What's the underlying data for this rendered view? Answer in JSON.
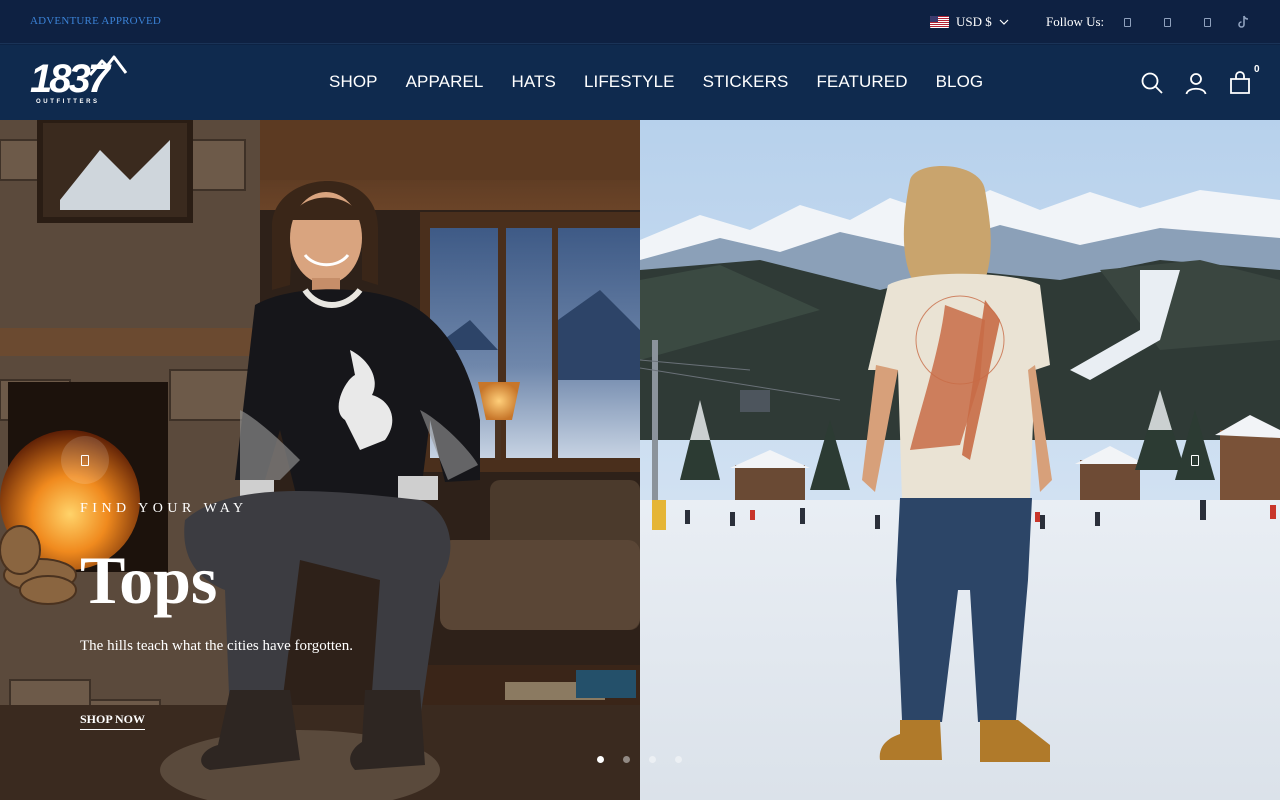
{
  "announcement": {
    "text": "ADVENTURE APPROVED"
  },
  "currency": {
    "selected": "USD $"
  },
  "social": {
    "label": "Follow Us:",
    "icons": [
      "facebook-icon",
      "instagram-icon",
      "pinterest-icon",
      "tiktok-icon"
    ]
  },
  "brand": {
    "logo_text": "1837",
    "logo_subtext": "OUTFITTERS"
  },
  "nav": {
    "items": [
      "SHOP",
      "APPAREL",
      "HATS",
      "LIFESTYLE",
      "STICKERS",
      "FEATURED",
      "BLOG"
    ]
  },
  "cart": {
    "count": "0"
  },
  "hero": {
    "eyebrow": "FIND YOUR WAY",
    "title": "Tops",
    "subtitle": "The hills teach what the cities have forgotten.",
    "cta": "SHOP NOW",
    "slides_total": 4,
    "active_slide": 1
  },
  "colors": {
    "topbar": "#0e2142",
    "header": "#0f2a4e",
    "accent_link": "#3b82d6"
  }
}
